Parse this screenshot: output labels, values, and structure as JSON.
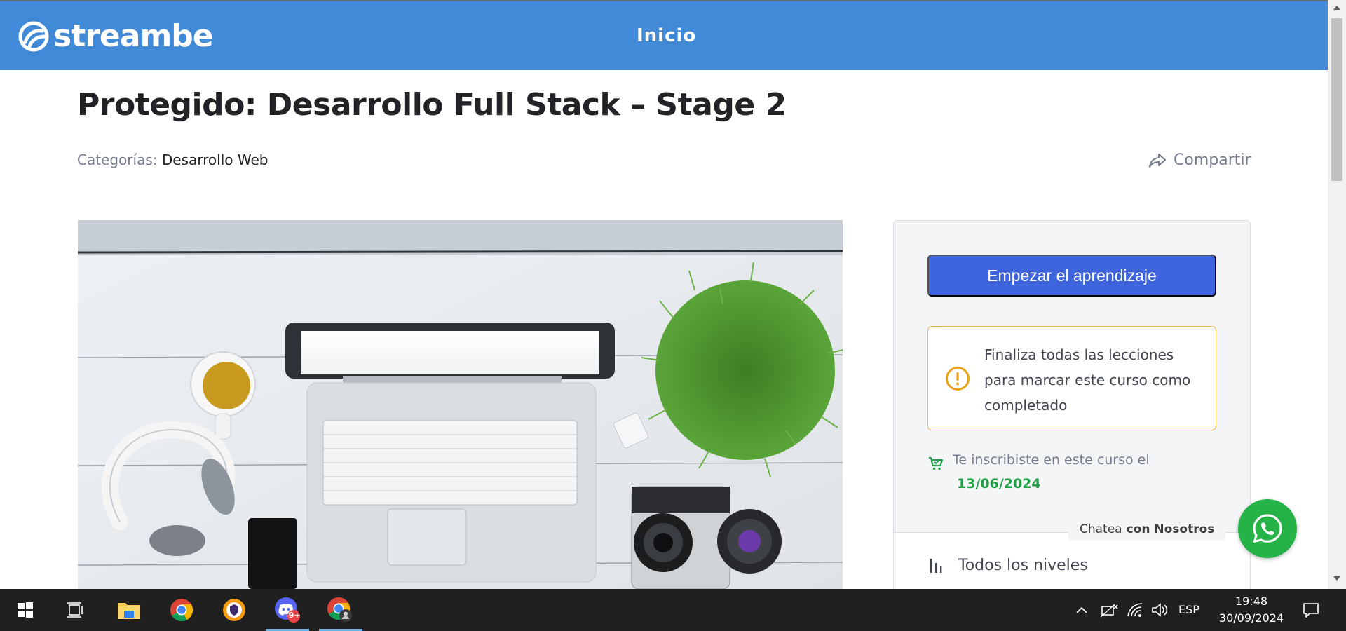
{
  "header": {
    "logo_text": "streambe",
    "nav_home": "Inicio",
    "background": "#418ad8"
  },
  "course": {
    "title": "Protegido: Desarrollo Full Stack – Stage 2",
    "categories_label": "Categorías:",
    "category": "Desarrollo Web",
    "share_label": "Compartir",
    "image_alt": "Escritorio con laptop, auriculares, taza, planta, cámara y teléfono"
  },
  "sidebar": {
    "start_button": "Empezar el aprendizaje",
    "notice_text": "Finaliza todas las lecciones para marcar este curso como completado",
    "enrolled_label": "Te inscribiste en este curso el",
    "enrolled_date": "13/06/2024",
    "level": "Todos los niveles",
    "accent": "#3e64de",
    "notice_border": "#ebb64b",
    "success": "#24a148"
  },
  "chat": {
    "label_prefix": "Chatea",
    "label_bold": "con Nosotros",
    "button_color": "#25b247"
  },
  "taskbar": {
    "apps": [
      "start-icon",
      "task-view-icon",
      "file-explorer-icon",
      "chrome-icon",
      "vpn-shield-icon",
      "discord-icon",
      "chrome-profile-icon"
    ],
    "discord_badge": "9+",
    "language": "ESP",
    "time": "19:48",
    "date": "30/09/2024"
  }
}
